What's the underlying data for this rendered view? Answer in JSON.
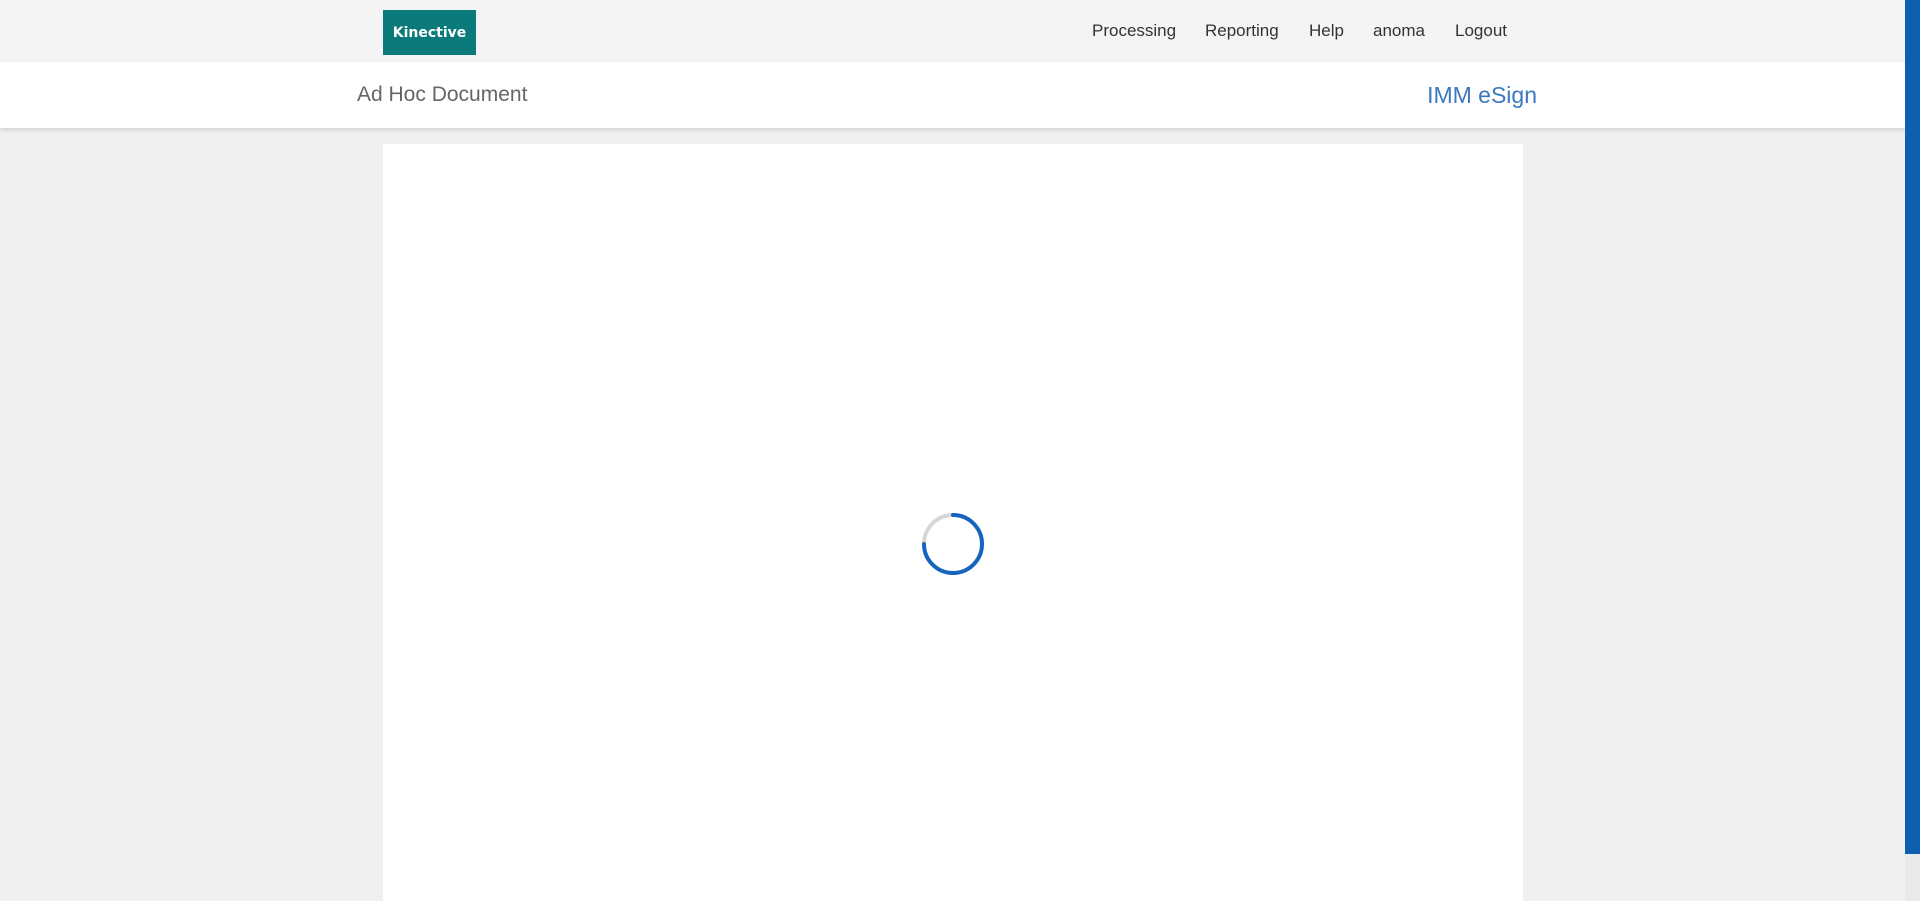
{
  "header": {
    "logo_text": "Kinective",
    "logo_color": "#0b7a7a",
    "nav": {
      "processing": "Processing",
      "reporting": "Reporting",
      "help": "Help",
      "user": "anoma",
      "logout": "Logout"
    }
  },
  "subheader": {
    "page_title": "Ad Hoc Document",
    "app_name": "IMM eSign",
    "app_name_color": "#3a78c0"
  },
  "document": {
    "status": "loading",
    "spinner_color": "#1565c0"
  },
  "scrollbar": {
    "thumb_color": "#0d5fb0"
  }
}
